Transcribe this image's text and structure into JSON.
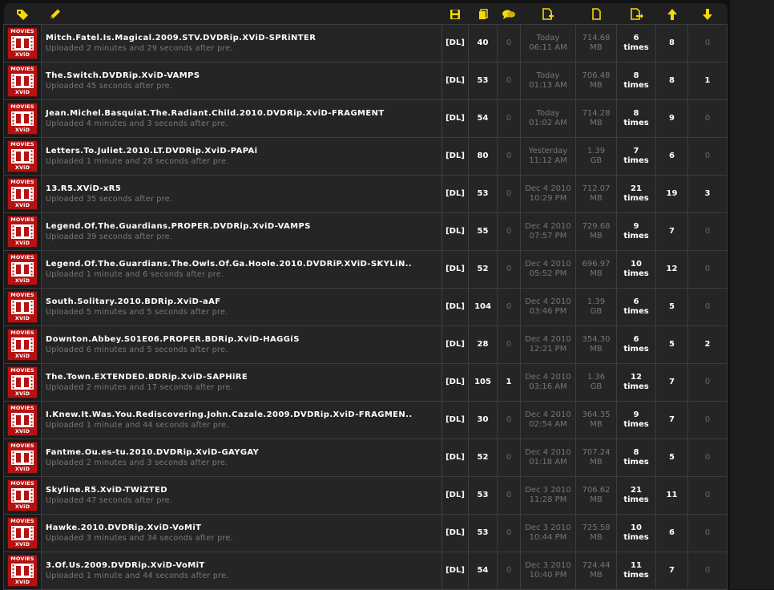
{
  "header_icons": [
    "tag-icon",
    "pencil-icon",
    "save-icon",
    "files-icon",
    "comments-icon",
    "file-add-icon",
    "file-icon",
    "file-export-icon",
    "arrow-up-icon",
    "arrow-down-icon"
  ],
  "colors": {
    "accent": "#f5d90a",
    "badge": "#b51212",
    "row": "#252525",
    "background": "#111111"
  },
  "category": {
    "top": "MOVIES",
    "bottom": "XViD"
  },
  "torrents": [
    {
      "name": "Mitch.Fatel.Is.Magical.2009.STV.DVDRip.XViD-SPRiNTER",
      "uploaded": "Uploaded 2 minutes and 29 seconds after pre.",
      "dl": "[DL]",
      "files": "40",
      "comments": "0",
      "date": "Today",
      "time": "06:11 AM",
      "size": "714.68",
      "unit": "MB",
      "snatched": "6",
      "snatched_label": "times",
      "seeders": "8",
      "leechers": "0"
    },
    {
      "name": "The.Switch.DVDRip.XviD-VAMPS",
      "uploaded": "Uploaded 45 seconds after pre.",
      "dl": "[DL]",
      "files": "53",
      "comments": "0",
      "date": "Today",
      "time": "01:13 AM",
      "size": "706.48",
      "unit": "MB",
      "snatched": "8",
      "snatched_label": "times",
      "seeders": "8",
      "leechers": "1"
    },
    {
      "name": "Jean.Michel.Basquiat.The.Radiant.Child.2010.DVDRip.XviD-FRAGMENT",
      "uploaded": "Uploaded 4 minutes and 3 seconds after pre.",
      "dl": "[DL]",
      "files": "54",
      "comments": "0",
      "date": "Today",
      "time": "01:02 AM",
      "size": "714.28",
      "unit": "MB",
      "snatched": "8",
      "snatched_label": "times",
      "seeders": "9",
      "leechers": "0"
    },
    {
      "name": "Letters.To.Juliet.2010.LT.DVDRip.XviD-PAPAi",
      "uploaded": "Uploaded 1 minute and 28 seconds after pre.",
      "dl": "[DL]",
      "files": "80",
      "comments": "0",
      "date": "Yesterday",
      "time": "11:12 AM",
      "size": "1.39",
      "unit": "GB",
      "snatched": "7",
      "snatched_label": "times",
      "seeders": "6",
      "leechers": "0"
    },
    {
      "name": "13.R5.XViD-xR5",
      "uploaded": "Uploaded 35 seconds after pre.",
      "dl": "[DL]",
      "files": "53",
      "comments": "0",
      "date": "Dec 4 2010",
      "time": "10:29 PM",
      "size": "712.07",
      "unit": "MB",
      "snatched": "21",
      "snatched_label": "times",
      "seeders": "19",
      "leechers": "3"
    },
    {
      "name": "Legend.Of.The.Guardians.PROPER.DVDRip.XviD-VAMPS",
      "uploaded": "Uploaded 39 seconds after pre.",
      "dl": "[DL]",
      "files": "55",
      "comments": "0",
      "date": "Dec 4 2010",
      "time": "07:57 PM",
      "size": "729.68",
      "unit": "MB",
      "snatched": "9",
      "snatched_label": "times",
      "seeders": "7",
      "leechers": "0"
    },
    {
      "name": "Legend.Of.The.Guardians.The.Owls.Of.Ga.Hoole.2010.DVDRiP.XViD-SKYLiN..",
      "uploaded": "Uploaded 1 minute and 6 seconds after pre.",
      "dl": "[DL]",
      "files": "52",
      "comments": "0",
      "date": "Dec 4 2010",
      "time": "05:52 PM",
      "size": "696.97",
      "unit": "MB",
      "snatched": "10",
      "snatched_label": "times",
      "seeders": "12",
      "leechers": "0"
    },
    {
      "name": "South.Solitary.2010.BDRip.XviD-aAF",
      "uploaded": "Uploaded 5 minutes and 5 seconds after pre.",
      "dl": "[DL]",
      "files": "104",
      "comments": "0",
      "date": "Dec 4 2010",
      "time": "03:46 PM",
      "size": "1.39",
      "unit": "GB",
      "snatched": "6",
      "snatched_label": "times",
      "seeders": "5",
      "leechers": "0"
    },
    {
      "name": "Downton.Abbey.S01E06.PROPER.BDRip.XviD-HAGGiS",
      "uploaded": "Uploaded 6 minutes and 5 seconds after pre.",
      "dl": "[DL]",
      "files": "28",
      "comments": "0",
      "date": "Dec 4 2010",
      "time": "12:21 PM",
      "size": "354.30",
      "unit": "MB",
      "snatched": "6",
      "snatched_label": "times",
      "seeders": "5",
      "leechers": "2"
    },
    {
      "name": "The.Town.EXTENDED.BDRip.XviD-SAPHiRE",
      "uploaded": "Uploaded 2 minutes and 17 seconds after pre.",
      "dl": "[DL]",
      "files": "105",
      "comments": "1",
      "date": "Dec 4 2010",
      "time": "03:16 AM",
      "size": "1.36",
      "unit": "GB",
      "snatched": "12",
      "snatched_label": "times",
      "seeders": "7",
      "leechers": "0"
    },
    {
      "name": "I.Knew.It.Was.You.Rediscovering.John.Cazale.2009.DVDRip.XviD-FRAGMEN..",
      "uploaded": "Uploaded 1 minute and 44 seconds after pre.",
      "dl": "[DL]",
      "files": "30",
      "comments": "0",
      "date": "Dec 4 2010",
      "time": "02:54 AM",
      "size": "364.35",
      "unit": "MB",
      "snatched": "9",
      "snatched_label": "times",
      "seeders": "7",
      "leechers": "0"
    },
    {
      "name": "Fantme.Ou.es-tu.2010.DVDRip.XviD-GAYGAY",
      "uploaded": "Uploaded 2 minutes and 3 seconds after pre.",
      "dl": "[DL]",
      "files": "52",
      "comments": "0",
      "date": "Dec 4 2010",
      "time": "01:18 AM",
      "size": "707.24",
      "unit": "MB",
      "snatched": "8",
      "snatched_label": "times",
      "seeders": "5",
      "leechers": "0"
    },
    {
      "name": "Skyline.R5.XviD-TWiZTED",
      "uploaded": "Uploaded 47 seconds after pre.",
      "dl": "[DL]",
      "files": "53",
      "comments": "0",
      "date": "Dec 3 2010",
      "time": "11:28 PM",
      "size": "706.62",
      "unit": "MB",
      "snatched": "21",
      "snatched_label": "times",
      "seeders": "11",
      "leechers": "0"
    },
    {
      "name": "Hawke.2010.DVDRip.XviD-VoMiT",
      "uploaded": "Uploaded 3 minutes and 34 seconds after pre.",
      "dl": "[DL]",
      "files": "53",
      "comments": "0",
      "date": "Dec 3 2010",
      "time": "10:44 PM",
      "size": "725.58",
      "unit": "MB",
      "snatched": "10",
      "snatched_label": "times",
      "seeders": "6",
      "leechers": "0"
    },
    {
      "name": "3.Of.Us.2009.DVDRip.XviD-VoMiT",
      "uploaded": "Uploaded 1 minute and 44 seconds after pre.",
      "dl": "[DL]",
      "files": "54",
      "comments": "0",
      "date": "Dec 3 2010",
      "time": "10:40 PM",
      "size": "724.44",
      "unit": "MB",
      "snatched": "11",
      "snatched_label": "times",
      "seeders": "7",
      "leechers": "0"
    }
  ]
}
